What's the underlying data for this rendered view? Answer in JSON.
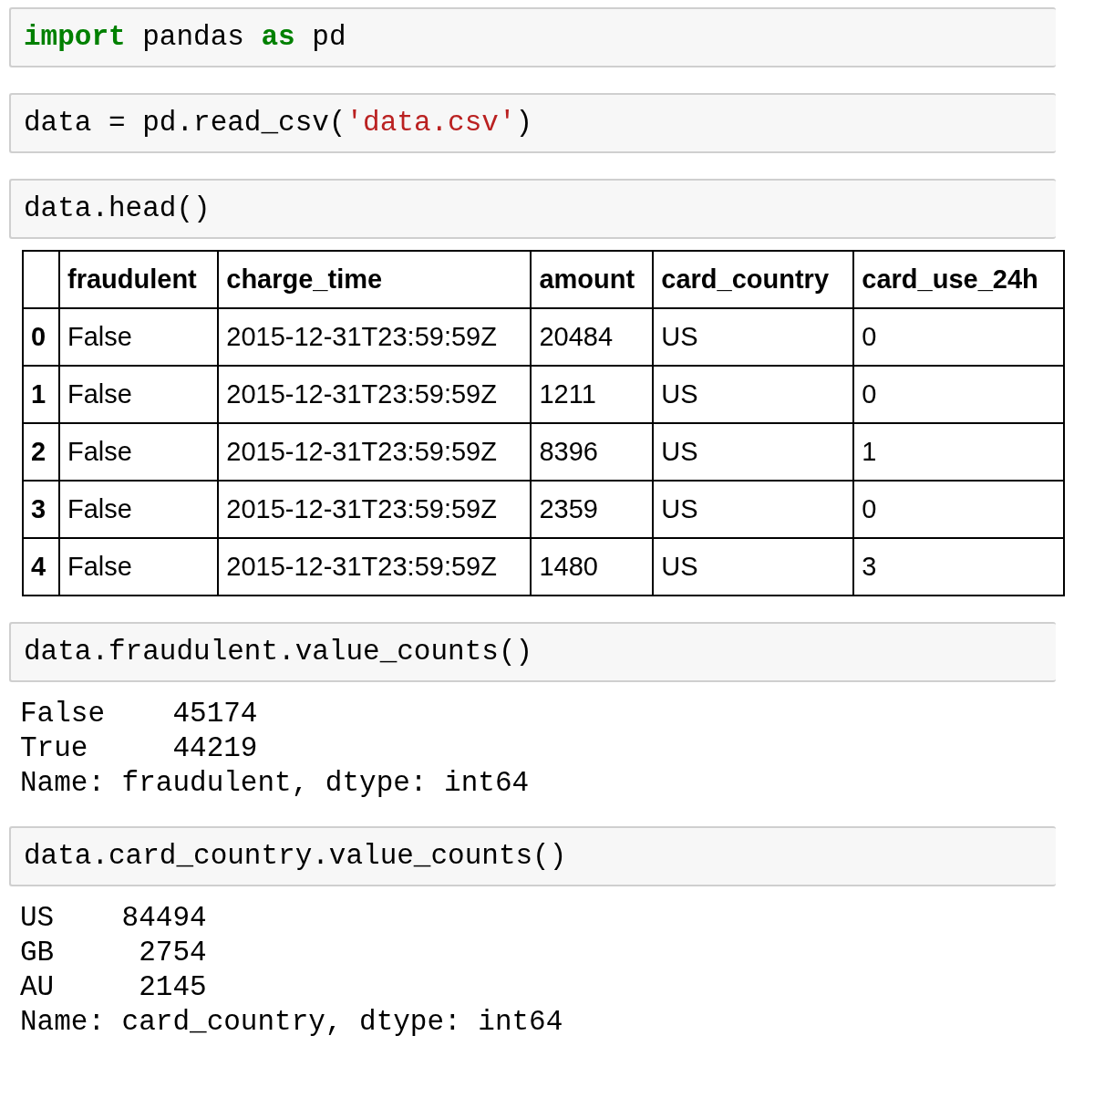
{
  "cells": [
    {
      "input": [
        {
          "kind": "keyword",
          "text": "import"
        },
        {
          "kind": "plain",
          "text": " pandas "
        },
        {
          "kind": "keyword",
          "text": "as"
        },
        {
          "kind": "plain",
          "text": " pd"
        }
      ]
    },
    {
      "input": [
        {
          "kind": "plain",
          "text": "data = pd.read_csv("
        },
        {
          "kind": "string",
          "text": "'data.csv'"
        },
        {
          "kind": "plain",
          "text": ")"
        }
      ]
    },
    {
      "input": [
        {
          "kind": "plain",
          "text": "data.head()"
        }
      ],
      "output": {
        "kind": "table",
        "columns": [
          "fraudulent",
          "charge_time",
          "amount",
          "card_country",
          "card_use_24h"
        ],
        "rows": [
          {
            "index": "0",
            "cells": [
              "False",
              "2015-12-31T23:59:59Z",
              "20484",
              "US",
              "0"
            ]
          },
          {
            "index": "1",
            "cells": [
              "False",
              "2015-12-31T23:59:59Z",
              "1211",
              "US",
              "0"
            ]
          },
          {
            "index": "2",
            "cells": [
              "False",
              "2015-12-31T23:59:59Z",
              "8396",
              "US",
              "1"
            ]
          },
          {
            "index": "3",
            "cells": [
              "False",
              "2015-12-31T23:59:59Z",
              "2359",
              "US",
              "0"
            ]
          },
          {
            "index": "4",
            "cells": [
              "False",
              "2015-12-31T23:59:59Z",
              "1480",
              "US",
              "3"
            ]
          }
        ]
      }
    },
    {
      "input": [
        {
          "kind": "plain",
          "text": "data.fraudulent.value_counts()"
        }
      ],
      "output": {
        "kind": "text",
        "lines": [
          "False    45174",
          "True     44219",
          "Name: fraudulent, dtype: int64"
        ]
      }
    },
    {
      "input": [
        {
          "kind": "plain",
          "text": "data.card_country.value_counts()"
        }
      ],
      "output": {
        "kind": "text",
        "lines": [
          "US    84494",
          "GB     2754",
          "AU     2145",
          "Name: card_country, dtype: int64"
        ]
      }
    }
  ]
}
